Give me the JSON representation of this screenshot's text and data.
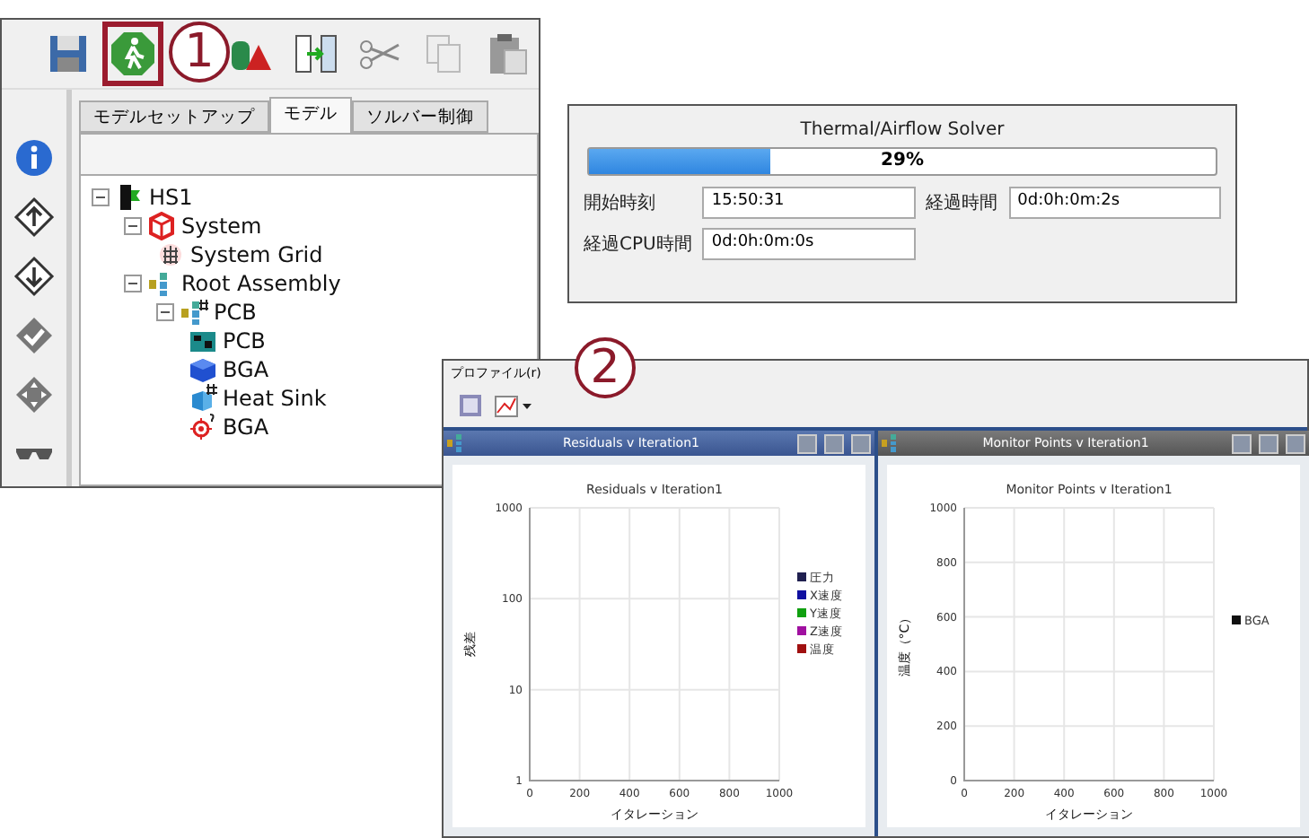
{
  "callouts": [
    {
      "label": "1"
    },
    {
      "label": "2"
    }
  ],
  "main_window": {
    "toolbar": [
      {
        "kind": "save",
        "selected": false
      },
      {
        "kind": "run",
        "selected": true
      },
      {
        "kind": "shapes",
        "selected": false
      },
      {
        "kind": "split",
        "selected": false
      },
      {
        "kind": "cut",
        "selected": false
      },
      {
        "kind": "copy",
        "selected": false
      },
      {
        "kind": "paste",
        "selected": false
      }
    ],
    "tabs": [
      {
        "label": "モデルセットアップ",
        "selected": false
      },
      {
        "label": "モデル",
        "selected": true
      },
      {
        "label": "ソルバー制御",
        "selected": false
      }
    ],
    "sidebar": [
      {
        "kind": "info"
      },
      {
        "kind": "up"
      },
      {
        "kind": "down"
      },
      {
        "kind": "check"
      },
      {
        "kind": "move"
      },
      {
        "kind": "glasses"
      }
    ],
    "tree": [
      {
        "label": "HS1",
        "kind": "model",
        "expanded": true,
        "children": [
          {
            "label": "System",
            "kind": "system",
            "expanded": true,
            "children": [
              {
                "label": "System Grid",
                "kind": "grid"
              }
            ]
          },
          {
            "label": "Root Assembly",
            "kind": "assembly",
            "expanded": true,
            "children": [
              {
                "label": "PCB",
                "kind": "assemblygrid",
                "expanded": true,
                "children": [
                  {
                    "label": "PCB",
                    "kind": "pcb"
                  },
                  {
                    "label": "BGA",
                    "kind": "block"
                  },
                  {
                    "label": "Heat Sink",
                    "kind": "heatsink"
                  },
                  {
                    "label": "BGA",
                    "kind": "monitor"
                  }
                ]
              }
            ]
          }
        ]
      }
    ]
  },
  "solver": {
    "title": "Thermal/Airflow Solver",
    "progress": {
      "level": 0.29,
      "reading": "29%"
    },
    "fields": [
      {
        "label": "開始時刻",
        "value": "15:50:31"
      },
      {
        "label": "経過時間",
        "value": "0d:0h:0m:2s"
      },
      {
        "label": "経過CPU時間",
        "value": "0d:0h:0m:0s"
      }
    ]
  },
  "profile": {
    "menu": "プロファイル(r)",
    "windows": [
      {
        "title": "Residuals v Iteration1",
        "selected": true,
        "chart_data": {
          "type": "line",
          "grid": true,
          "title": "Residuals v Iteration1",
          "xlabel": "イタレーション",
          "ylabel": "残差",
          "categories": [
            "0",
            "200",
            "400",
            "600",
            "800",
            "1000"
          ],
          "ylim": [
            1,
            1000
          ],
          "yticks": [
            1,
            10,
            100,
            1000
          ],
          "log": true,
          "series": [
            {
              "name": "圧力",
              "color": "#202050",
              "values": [
                null,
                null,
                null,
                null,
                null,
                null
              ]
            },
            {
              "name": "X速度",
              "color": "#1010a0",
              "values": [
                null,
                null,
                null,
                null,
                null,
                null
              ]
            },
            {
              "name": "Y速度",
              "color": "#10a010",
              "values": [
                null,
                null,
                null,
                null,
                null,
                null
              ]
            },
            {
              "name": "Z速度",
              "color": "#a010a0",
              "values": [
                null,
                null,
                null,
                null,
                null,
                null
              ]
            },
            {
              "name": "温度",
              "color": "#a01010",
              "values": [
                null,
                null,
                null,
                null,
                null,
                null
              ]
            }
          ]
        }
      },
      {
        "title": "Monitor Points v Iteration1",
        "selected": false,
        "chart_data": {
          "type": "line",
          "grid": true,
          "title": "Monitor Points v Iteration1",
          "xlabel": "イタレーション",
          "ylabel": "温度（°C）",
          "categories": [
            "0",
            "200",
            "400",
            "600",
            "800",
            "1000"
          ],
          "ylim": [
            0,
            1000
          ],
          "yticks": [
            0,
            200,
            400,
            600,
            800,
            1000
          ],
          "log": false,
          "series": [
            {
              "name": "BGA",
              "color": "#101010",
              "values": [
                null,
                null,
                null,
                null,
                null,
                null
              ]
            }
          ]
        }
      }
    ]
  }
}
